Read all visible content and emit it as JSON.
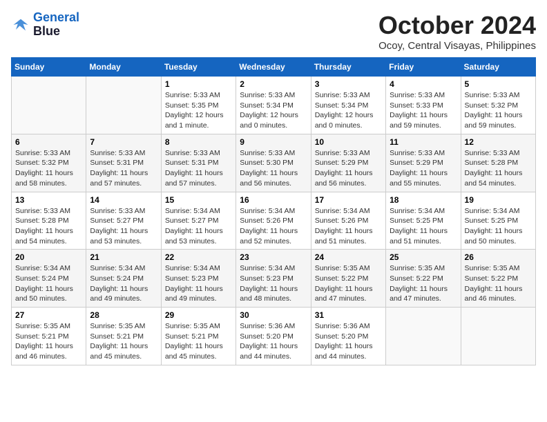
{
  "header": {
    "logo_line1": "General",
    "logo_line2": "Blue",
    "month_year": "October 2024",
    "location": "Ocoy, Central Visayas, Philippines"
  },
  "days_of_week": [
    "Sunday",
    "Monday",
    "Tuesday",
    "Wednesday",
    "Thursday",
    "Friday",
    "Saturday"
  ],
  "weeks": [
    [
      {
        "day": "",
        "info": ""
      },
      {
        "day": "",
        "info": ""
      },
      {
        "day": "1",
        "info": "Sunrise: 5:33 AM\nSunset: 5:35 PM\nDaylight: 12 hours\nand 1 minute."
      },
      {
        "day": "2",
        "info": "Sunrise: 5:33 AM\nSunset: 5:34 PM\nDaylight: 12 hours\nand 0 minutes."
      },
      {
        "day": "3",
        "info": "Sunrise: 5:33 AM\nSunset: 5:34 PM\nDaylight: 12 hours\nand 0 minutes."
      },
      {
        "day": "4",
        "info": "Sunrise: 5:33 AM\nSunset: 5:33 PM\nDaylight: 11 hours\nand 59 minutes."
      },
      {
        "day": "5",
        "info": "Sunrise: 5:33 AM\nSunset: 5:32 PM\nDaylight: 11 hours\nand 59 minutes."
      }
    ],
    [
      {
        "day": "6",
        "info": "Sunrise: 5:33 AM\nSunset: 5:32 PM\nDaylight: 11 hours\nand 58 minutes."
      },
      {
        "day": "7",
        "info": "Sunrise: 5:33 AM\nSunset: 5:31 PM\nDaylight: 11 hours\nand 57 minutes."
      },
      {
        "day": "8",
        "info": "Sunrise: 5:33 AM\nSunset: 5:31 PM\nDaylight: 11 hours\nand 57 minutes."
      },
      {
        "day": "9",
        "info": "Sunrise: 5:33 AM\nSunset: 5:30 PM\nDaylight: 11 hours\nand 56 minutes."
      },
      {
        "day": "10",
        "info": "Sunrise: 5:33 AM\nSunset: 5:29 PM\nDaylight: 11 hours\nand 56 minutes."
      },
      {
        "day": "11",
        "info": "Sunrise: 5:33 AM\nSunset: 5:29 PM\nDaylight: 11 hours\nand 55 minutes."
      },
      {
        "day": "12",
        "info": "Sunrise: 5:33 AM\nSunset: 5:28 PM\nDaylight: 11 hours\nand 54 minutes."
      }
    ],
    [
      {
        "day": "13",
        "info": "Sunrise: 5:33 AM\nSunset: 5:28 PM\nDaylight: 11 hours\nand 54 minutes."
      },
      {
        "day": "14",
        "info": "Sunrise: 5:33 AM\nSunset: 5:27 PM\nDaylight: 11 hours\nand 53 minutes."
      },
      {
        "day": "15",
        "info": "Sunrise: 5:34 AM\nSunset: 5:27 PM\nDaylight: 11 hours\nand 53 minutes."
      },
      {
        "day": "16",
        "info": "Sunrise: 5:34 AM\nSunset: 5:26 PM\nDaylight: 11 hours\nand 52 minutes."
      },
      {
        "day": "17",
        "info": "Sunrise: 5:34 AM\nSunset: 5:26 PM\nDaylight: 11 hours\nand 51 minutes."
      },
      {
        "day": "18",
        "info": "Sunrise: 5:34 AM\nSunset: 5:25 PM\nDaylight: 11 hours\nand 51 minutes."
      },
      {
        "day": "19",
        "info": "Sunrise: 5:34 AM\nSunset: 5:25 PM\nDaylight: 11 hours\nand 50 minutes."
      }
    ],
    [
      {
        "day": "20",
        "info": "Sunrise: 5:34 AM\nSunset: 5:24 PM\nDaylight: 11 hours\nand 50 minutes."
      },
      {
        "day": "21",
        "info": "Sunrise: 5:34 AM\nSunset: 5:24 PM\nDaylight: 11 hours\nand 49 minutes."
      },
      {
        "day": "22",
        "info": "Sunrise: 5:34 AM\nSunset: 5:23 PM\nDaylight: 11 hours\nand 49 minutes."
      },
      {
        "day": "23",
        "info": "Sunrise: 5:34 AM\nSunset: 5:23 PM\nDaylight: 11 hours\nand 48 minutes."
      },
      {
        "day": "24",
        "info": "Sunrise: 5:35 AM\nSunset: 5:22 PM\nDaylight: 11 hours\nand 47 minutes."
      },
      {
        "day": "25",
        "info": "Sunrise: 5:35 AM\nSunset: 5:22 PM\nDaylight: 11 hours\nand 47 minutes."
      },
      {
        "day": "26",
        "info": "Sunrise: 5:35 AM\nSunset: 5:22 PM\nDaylight: 11 hours\nand 46 minutes."
      }
    ],
    [
      {
        "day": "27",
        "info": "Sunrise: 5:35 AM\nSunset: 5:21 PM\nDaylight: 11 hours\nand 46 minutes."
      },
      {
        "day": "28",
        "info": "Sunrise: 5:35 AM\nSunset: 5:21 PM\nDaylight: 11 hours\nand 45 minutes."
      },
      {
        "day": "29",
        "info": "Sunrise: 5:35 AM\nSunset: 5:21 PM\nDaylight: 11 hours\nand 45 minutes."
      },
      {
        "day": "30",
        "info": "Sunrise: 5:36 AM\nSunset: 5:20 PM\nDaylight: 11 hours\nand 44 minutes."
      },
      {
        "day": "31",
        "info": "Sunrise: 5:36 AM\nSunset: 5:20 PM\nDaylight: 11 hours\nand 44 minutes."
      },
      {
        "day": "",
        "info": ""
      },
      {
        "day": "",
        "info": ""
      }
    ]
  ]
}
